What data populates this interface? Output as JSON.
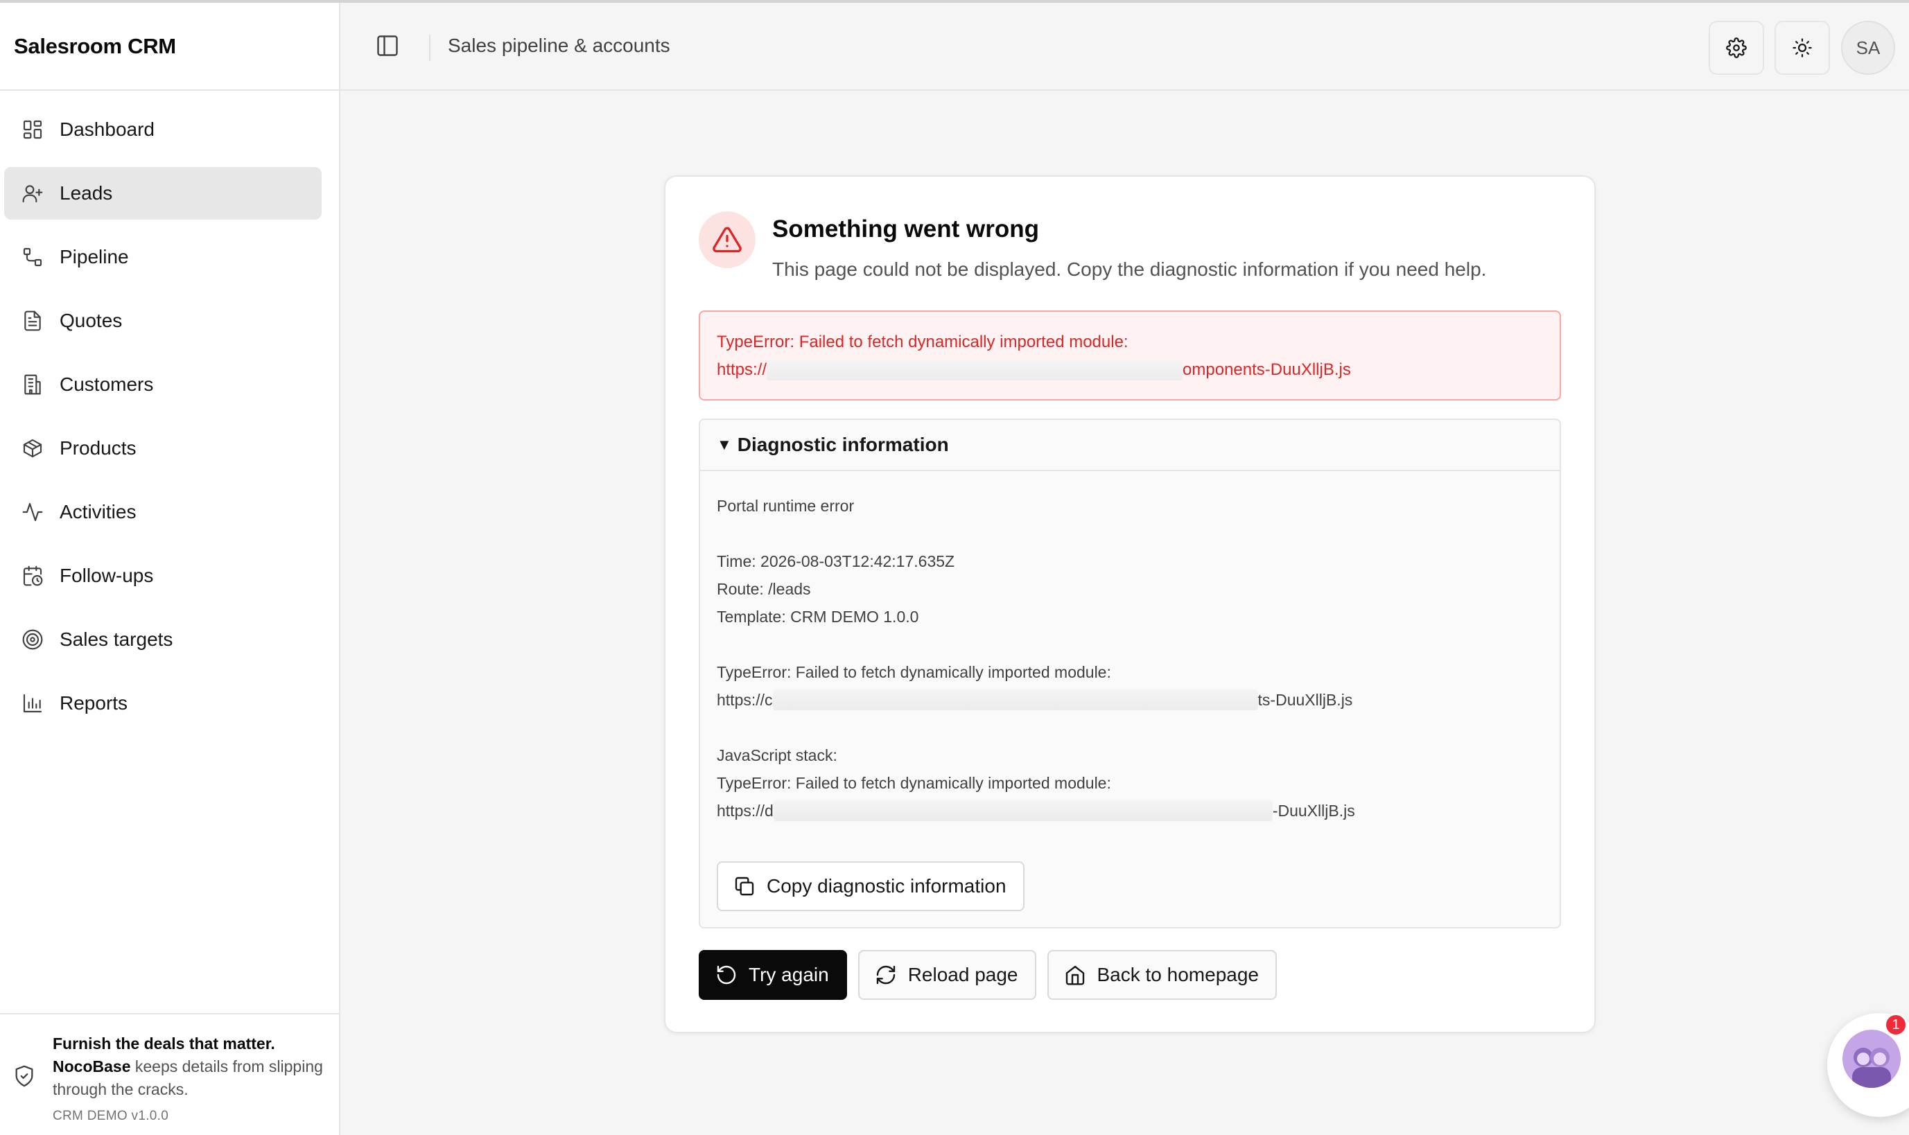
{
  "app": {
    "brand": "Salesroom CRM",
    "header_title": "Sales pipeline & accounts",
    "user_initials": "SA"
  },
  "sidebar": {
    "items": [
      {
        "label": "Dashboard",
        "icon": "dashboard-icon",
        "active": false
      },
      {
        "label": "Leads",
        "icon": "user-plus-icon",
        "active": true
      },
      {
        "label": "Pipeline",
        "icon": "pipeline-icon",
        "active": false
      },
      {
        "label": "Quotes",
        "icon": "document-icon",
        "active": false
      },
      {
        "label": "Customers",
        "icon": "building-icon",
        "active": false
      },
      {
        "label": "Products",
        "icon": "package-icon",
        "active": false
      },
      {
        "label": "Activities",
        "icon": "activity-icon",
        "active": false
      },
      {
        "label": "Follow-ups",
        "icon": "calendar-clock-icon",
        "active": false
      },
      {
        "label": "Sales targets",
        "icon": "target-icon",
        "active": false
      },
      {
        "label": "Reports",
        "icon": "bar-chart-icon",
        "active": false
      }
    ],
    "footer": {
      "headline": "Furnish the deals that matter.",
      "brand_word": "NocoBase",
      "tagline": " keeps details from slipping through the cracks.",
      "version": "CRM DEMO v1.0.0"
    }
  },
  "error": {
    "title": "Something went wrong",
    "subtitle": "This page could not be displayed. Copy the diagnostic information if you need help.",
    "message_line1": "TypeError: Failed to fetch dynamically imported module:",
    "url_prefix": "https://",
    "url_suffix": "omponents-DuuXlljB.js"
  },
  "diagnostic": {
    "heading": "Diagnostic information",
    "kind": "Portal runtime error",
    "time": "Time: 2026-08-03T12:42:17.635Z",
    "route": "Route: /leads",
    "template": "Template: CRM DEMO 1.0.0",
    "error_line": "TypeError: Failed to fetch dynamically imported module:",
    "url1_prefix": "https://c",
    "url1_suffix": "ts-DuuXlljB.js",
    "stack_label": "JavaScript stack:",
    "stack_error_line": "TypeError: Failed to fetch dynamically imported module:",
    "url2_prefix": "https://d",
    "url2_suffix": "-DuuXlljB.js",
    "copy_label": "Copy diagnostic information"
  },
  "actions": {
    "try_again": "Try again",
    "reload": "Reload page",
    "home": "Back to homepage"
  },
  "chat": {
    "badge_count": "1"
  },
  "colors": {
    "accent_error": "#dc2626",
    "error_bg": "#fef2f2",
    "primary_button": "#0a0a0a",
    "active_nav": "#e7e7e7"
  }
}
